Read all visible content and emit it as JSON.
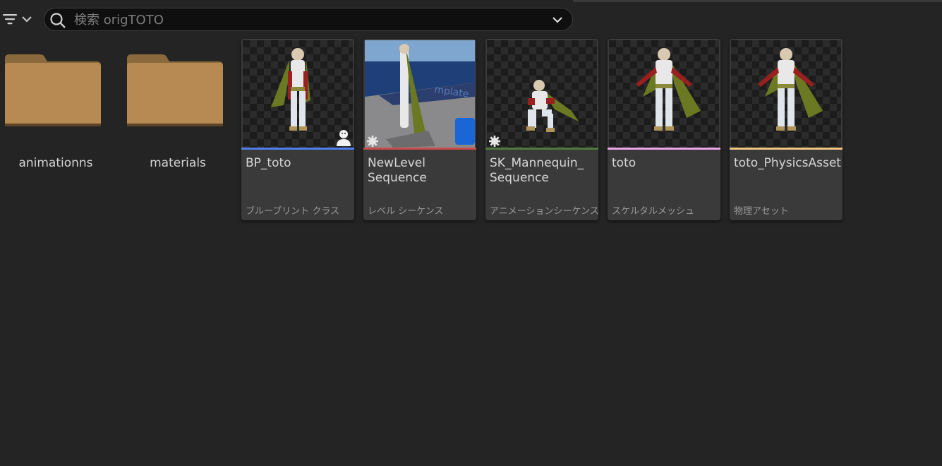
{
  "toolbar": {
    "filter_icon": "filter-lines-icon",
    "search_placeholder": "検索 origTOTO",
    "search_value": ""
  },
  "folders": [
    {
      "label": "animationns"
    },
    {
      "label": "materials"
    }
  ],
  "assets": [
    {
      "name": "BP_toto",
      "type": "ブループリント クラス",
      "color": "#4e7fe8",
      "badge": "pawn-icon"
    },
    {
      "name": "NewLevel\nSequence",
      "type": "レベル シーケンス",
      "color": "#c94b4b",
      "badge": "gear-icon"
    },
    {
      "name": "SK_Mannequin_\nSequence",
      "type": "アニメーションシーケンス",
      "color": "#4f7a3f",
      "badge": "gear-icon"
    },
    {
      "name": "toto",
      "type": "スケルタルメッシュ",
      "color": "#e9a7ea",
      "badge": ""
    },
    {
      "name": "toto_PhysicsAsset",
      "type": "物理アセット",
      "color": "#efc680",
      "badge": ""
    }
  ],
  "colors": {
    "background": "#242424",
    "card": "#3a3a3a",
    "folder": "#b68a52"
  }
}
